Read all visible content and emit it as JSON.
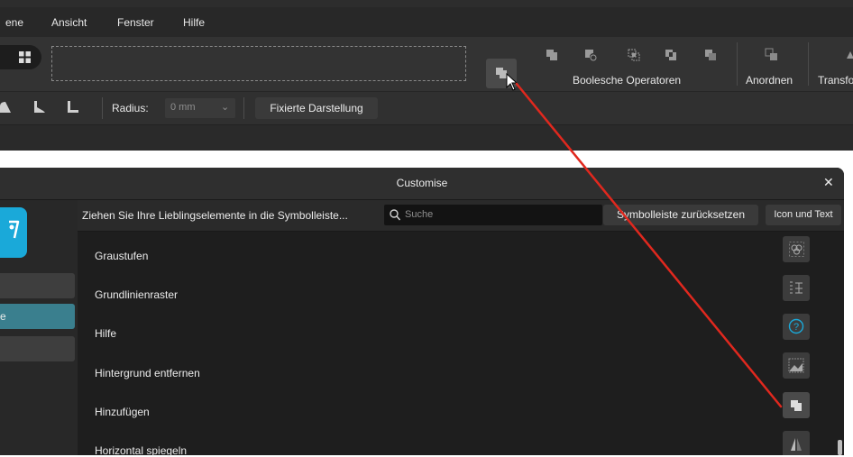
{
  "menubar": {
    "items": [
      "ene",
      "Ansicht",
      "Fenster",
      "Hilfe"
    ]
  },
  "toolbar": {
    "boolean_label": "Boolesche Operatoren",
    "arrange_label": "Anordnen",
    "transform_label": "Transfo"
  },
  "context": {
    "radius_label": "Radius:",
    "radius_value": "0 mm",
    "fixed_view_label": "Fixierte Darstellung"
  },
  "dialog": {
    "title": "Customise",
    "close_glyph": "✕",
    "hint": "Ziehen Sie Ihre Lieblingselemente in die Symbolleiste...",
    "search_placeholder": "Suche",
    "reset_label": "Symbolleiste zurücksetzen",
    "mode_label": "Icon und Text",
    "sidebar_selected_text": "e",
    "items": [
      {
        "label": "Graustufen",
        "icon": "channels-icon"
      },
      {
        "label": "Grundlinienraster",
        "icon": "baseline-grid-icon"
      },
      {
        "label": "Hilfe",
        "icon": "help-icon"
      },
      {
        "label": "Hintergrund entfernen",
        "icon": "remove-background-icon"
      },
      {
        "label": "Hinzufügen",
        "icon": "boolean-add-icon"
      },
      {
        "label": "Horizontal spiegeln",
        "icon": "flip-horizontal-icon"
      }
    ]
  },
  "colors": {
    "accent": "#1aa9d9",
    "annotation": "#e0281e",
    "selected_sidebar": "#3a7f8e"
  }
}
